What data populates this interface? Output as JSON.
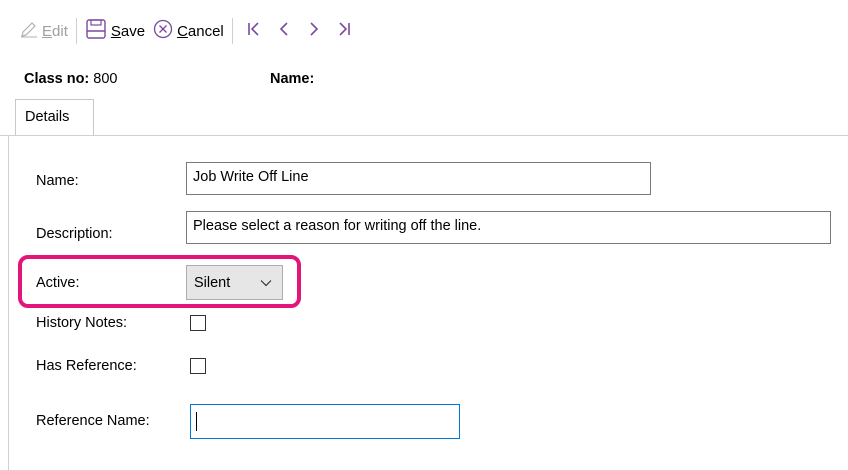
{
  "toolbar": {
    "edit_label": "Edit",
    "save_label": "Save",
    "cancel_label": "Cancel",
    "icon_color": "#7b4a9e"
  },
  "header": {
    "class_no_label": "Class no:",
    "class_no_value": "800",
    "name_label": "Name:"
  },
  "tabs": [
    {
      "label": "Details",
      "selected": true
    }
  ],
  "form": {
    "name_label": "Name:",
    "name_value": "Job Write Off Line",
    "description_label": "Description:",
    "description_value": "Please select a reason for writing off the line.",
    "active_label": "Active:",
    "active_value": "Silent",
    "history_notes_label": "History Notes:",
    "history_notes_checked": false,
    "has_reference_label": "Has Reference:",
    "has_reference_checked": false,
    "reference_name_label": "Reference Name:",
    "reference_name_value": ""
  },
  "highlight_color": "#e4157a"
}
